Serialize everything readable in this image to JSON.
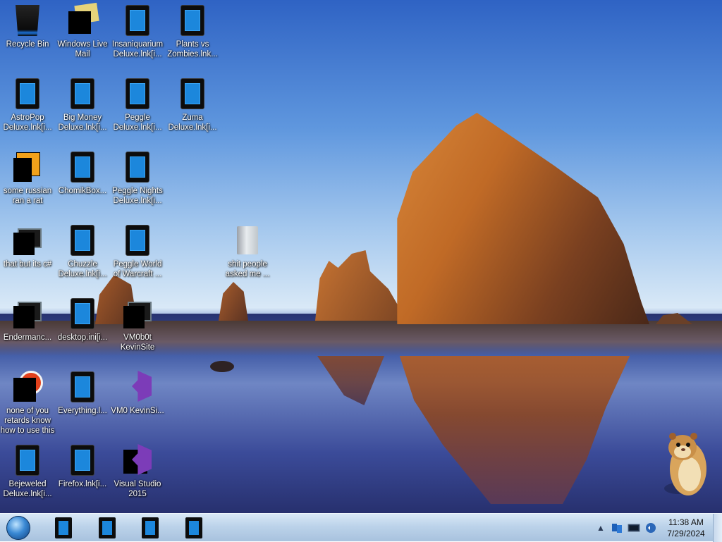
{
  "desktop": {
    "icons": [
      {
        "label": "Recycle Bin",
        "icon": "recycle-bin-icon"
      },
      {
        "label": "Windows Live Mail",
        "icon": "mail-icon"
      },
      {
        "label": "Insaniquarium Deluxe.lnk[i...",
        "icon": "game-shortcut-icon"
      },
      {
        "label": "Plants vs Zombies.lnk...",
        "icon": "game-shortcut-icon"
      },
      {
        "label": "AstroPop Deluxe.lnk[i...",
        "icon": "game-shortcut-icon"
      },
      {
        "label": "Big Money Deluxe.lnk[i...",
        "icon": "game-shortcut-icon"
      },
      {
        "label": "Peggle Deluxe.lnk[i...",
        "icon": "game-shortcut-icon"
      },
      {
        "label": "Zuma Deluxe.lnk[i...",
        "icon": "game-shortcut-icon"
      },
      {
        "label": "some russian ran a rat",
        "icon": "app-icon"
      },
      {
        "label": "ChomikBox...",
        "icon": "game-shortcut-icon"
      },
      {
        "label": "Peggle Nights Deluxe.lnk[i...",
        "icon": "game-shortcut-icon"
      },
      {
        "label": "that but its c#",
        "icon": "file-icon"
      },
      {
        "label": "Chuzzle Deluxe.lnk[i...",
        "icon": "game-shortcut-icon"
      },
      {
        "label": "Peggle World of Warcraft ...",
        "icon": "game-shortcut-icon"
      },
      {
        "label": "shit people asked me ...",
        "icon": "folder-icon"
      },
      {
        "label": "Endermanc...",
        "icon": "monitor-icon"
      },
      {
        "label": "desktop.ini[i...",
        "icon": "game-shortcut-icon"
      },
      {
        "label": "VM0b0t KevinSite",
        "icon": "monitor-icon"
      },
      {
        "label": "none of you retards know how to use this",
        "icon": "browser-icon"
      },
      {
        "label": "Everything.l...",
        "icon": "game-shortcut-icon"
      },
      {
        "label": "VM0 KevinSi...",
        "icon": "vs-icon"
      },
      {
        "label": "Bejeweled Deluxe.lnk[i...",
        "icon": "game-shortcut-icon"
      },
      {
        "label": "Firefox.lnk[i...",
        "icon": "game-shortcut-icon"
      },
      {
        "label": "Visual Studio 2015",
        "icon": "vs-icon"
      }
    ]
  },
  "taskbar": {
    "start": "start-orb-icon",
    "pinned_count": 4,
    "tray": {
      "arrow": "▲",
      "clock_time": "11:38 AM",
      "clock_date": "7/29/2024"
    }
  },
  "colors": {
    "taskbar": "#bcd3ea",
    "icon_blue": "#1c87dc"
  }
}
